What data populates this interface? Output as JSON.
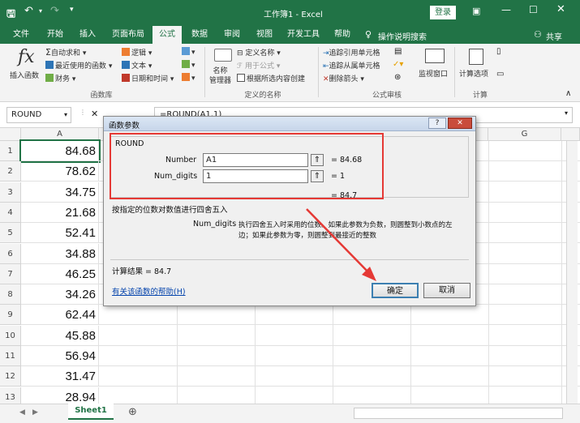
{
  "window": {
    "title": "工作簿1 - Excel",
    "login": "登录",
    "share": "共享"
  },
  "tabs": [
    "文件",
    "开始",
    "插入",
    "页面布局",
    "公式",
    "数据",
    "审阅",
    "视图",
    "开发工具",
    "帮助"
  ],
  "active_tab": "公式",
  "tell_me": "操作说明搜索",
  "ribbon": {
    "insert_function": "插入函数",
    "autosum": "自动求和",
    "recent": "最近使用的函数",
    "financial": "财务",
    "logical": "逻辑",
    "text": "文本",
    "datetime": "日期和时间",
    "group_library": "函数库",
    "name_manager": "名称\n管理器",
    "define_name": "定义名称",
    "use_in_formula": "用于公式",
    "create_from_selection": "根据所选内容创建",
    "group_names": "定义的名称",
    "trace_precedents": "追踪引用单元格",
    "trace_dependents": "追踪从属单元格",
    "remove_arrows": "删除箭头",
    "watch_window": "监视窗口",
    "group_audit": "公式审核",
    "calc_options": "计算选项",
    "group_calc": "计算"
  },
  "formula_bar": {
    "name_box": "ROUND",
    "formula": "=ROUND(A1,1)"
  },
  "columns": [
    "A",
    "G"
  ],
  "rows": [
    {
      "num": "1",
      "value": "84.68"
    },
    {
      "num": "2",
      "value": "78.62"
    },
    {
      "num": "3",
      "value": "34.75"
    },
    {
      "num": "4",
      "value": "21.68"
    },
    {
      "num": "5",
      "value": "52.41"
    },
    {
      "num": "6",
      "value": "34.88"
    },
    {
      "num": "7",
      "value": "46.25"
    },
    {
      "num": "8",
      "value": "34.26"
    },
    {
      "num": "9",
      "value": "62.44"
    },
    {
      "num": "10",
      "value": "45.88"
    },
    {
      "num": "11",
      "value": "56.94"
    },
    {
      "num": "12",
      "value": "31.47"
    },
    {
      "num": "13",
      "value": "28.94"
    }
  ],
  "sheet_tab": "Sheet1",
  "dialog": {
    "title": "函数参数",
    "function_name": "ROUND",
    "arg1_label": "Number",
    "arg1_value": "A1",
    "arg1_result": "= 84.68",
    "arg2_label": "Num_digits",
    "arg2_value": "1",
    "arg2_result": "= 1",
    "func_result": "= 84.7",
    "description": "按指定的位数对数值进行四舍五入",
    "arg_desc_label": "Num_digits",
    "arg_desc_line1": "执行四舍五入时采用的位数。如果此参数为负数，则圆整到小数点的左",
    "arg_desc_line2": "边；如果此参数为零，则圆整到最接近的整数",
    "calc_result": "计算结果 =  84.7",
    "help_link": "有关该函数的帮助(H)",
    "ok": "确定",
    "cancel": "取消"
  },
  "colors": {
    "excel_green": "#217346",
    "highlight_red": "#e53935",
    "link_blue": "#0645ad"
  }
}
